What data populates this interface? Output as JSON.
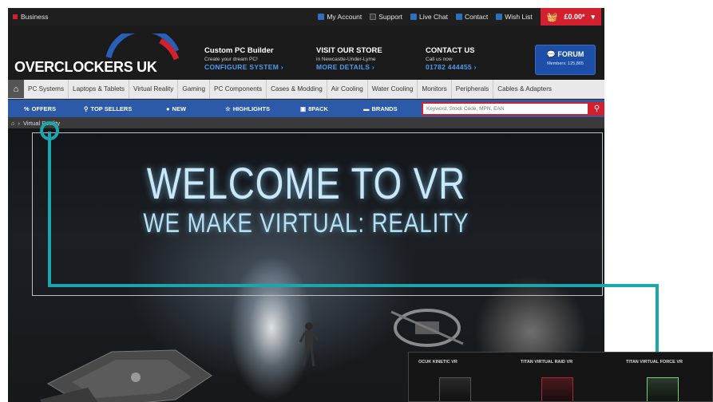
{
  "topbar": {
    "business": "Business",
    "links": [
      {
        "label": "My Account",
        "icon": "user-icon"
      },
      {
        "label": "Support",
        "icon": "support-icon"
      },
      {
        "label": "Live Chat",
        "icon": "chat-icon"
      },
      {
        "label": "Contact",
        "icon": "mail-icon"
      },
      {
        "label": "Wish List",
        "icon": "heart-icon"
      }
    ],
    "basket_total": "£0.00*"
  },
  "header": {
    "logo": "OVERCLOCKERS UK",
    "builder": {
      "title": "Custom PC Builder",
      "sub": "Create your dream PC!",
      "link": "CONFIGURE SYSTEM ›"
    },
    "store": {
      "title": "VISIT OUR STORE",
      "sub": "in Newcastle-Under-Lyme",
      "link": "MORE DETAILS ›"
    },
    "contact": {
      "title": "CONTACT US",
      "sub": "Call us now",
      "link": "01782 444455 ›"
    },
    "forum": {
      "label": "FORUM",
      "members": "Members: 125,865"
    }
  },
  "catnav": [
    "PC Systems",
    "Laptops & Tablets",
    "Virtual Reality",
    "Gaming",
    "PC Components",
    "Cases & Modding",
    "Air Cooling",
    "Water Cooling",
    "Monitors",
    "Peripherals",
    "Cables & Adapters"
  ],
  "bluebar": {
    "items": [
      {
        "label": "OFFERS",
        "icon": "percent-icon"
      },
      {
        "label": "TOP SELLERS",
        "icon": "pin-icon"
      },
      {
        "label": "NEW",
        "icon": "info-icon"
      },
      {
        "label": "HIGHLIGHTS",
        "icon": "star-icon"
      },
      {
        "label": "8PACK",
        "icon": "box-icon"
      },
      {
        "label": "BRANDS",
        "icon": "tag-icon"
      }
    ],
    "search_placeholder": "Keyword, Stock Code, MPN, EAN"
  },
  "breadcrumb": {
    "current": "Virtual Reality"
  },
  "hero": {
    "line1": "WELCOME TO VR",
    "line2": "WE MAKE VIRTUAL: REALITY"
  },
  "products": [
    "OCUK KINETIC VR",
    "TITAN VIRTUAL RAID VR",
    "TITAN VIRTUAL FORCE VR"
  ],
  "colors": {
    "brand_red": "#d2202f",
    "nav_blue": "#2c59a8",
    "callout_teal": "#1aa6ad"
  }
}
